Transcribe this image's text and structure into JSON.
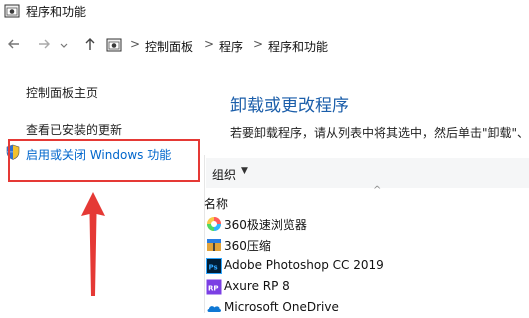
{
  "window": {
    "title": "程序和功能"
  },
  "nav": {
    "back_icon": "arrow-left-icon",
    "forward_icon": "arrow-right-icon",
    "recent_icon": "chevron-down-icon",
    "up_icon": "arrow-up-icon",
    "breadcrumb": [
      "控制面板",
      "程序",
      "程序和功能"
    ],
    "separator": ">"
  },
  "sidebar": {
    "items": [
      {
        "label": "控制面板主页"
      },
      {
        "label": "查看已安装的更新"
      },
      {
        "label": "启用或关闭 Windows 功能"
      }
    ]
  },
  "main": {
    "title": "卸载或更改程序",
    "description": "若要卸载程序，请从列表中将其选中，然后单击\"卸载\"、"
  },
  "toolbar": {
    "organize_label": "组织",
    "caret": "▼"
  },
  "list": {
    "sort_indicator": "^",
    "column_name": "名称",
    "programs": [
      {
        "name": "360极速浏览器",
        "icon": "360-browser-icon"
      },
      {
        "name": "360压缩",
        "icon": "360-zip-icon"
      },
      {
        "name": "Adobe Photoshop CC 2019",
        "icon": "photoshop-icon"
      },
      {
        "name": "Axure RP 8",
        "icon": "axure-icon"
      },
      {
        "name": "Microsoft OneDrive",
        "icon": "onedrive-icon"
      }
    ]
  },
  "annotation": {
    "color": "#e53935"
  },
  "colors": {
    "link": "#0066cc",
    "title": "#1b5eaa"
  }
}
